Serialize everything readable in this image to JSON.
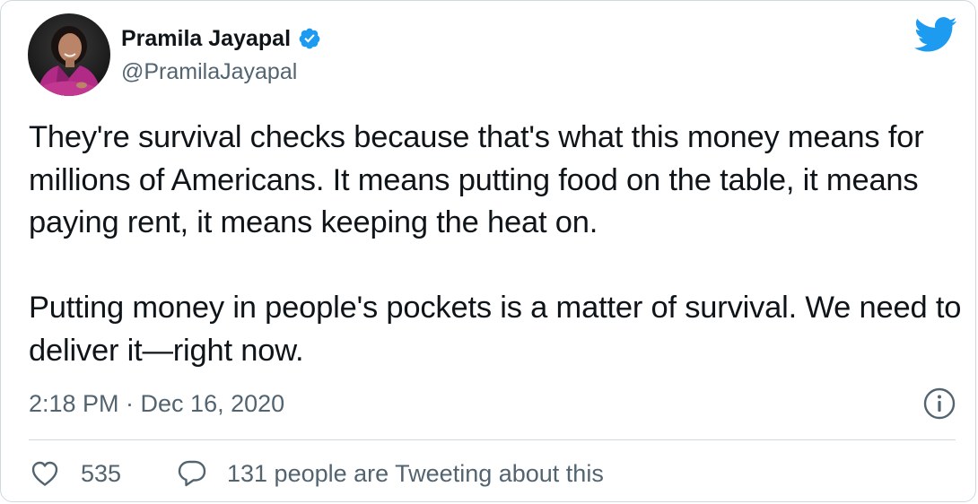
{
  "author": {
    "display_name": "Pramila Jayapal",
    "handle": "@PramilaJayapal",
    "verified": true
  },
  "tweet": {
    "paragraphs": [
      "They're survival checks because that's what this money means for millions of Americans. It means putting food on the table, it means paying rent, it means keeping the heat on.",
      "Putting money in people's pockets is a matter of survival. We need to deliver it—right now."
    ],
    "timestamp": "2:18 PM · Dec 16, 2020"
  },
  "footer": {
    "likes": "535",
    "tweeting": "131 people are Tweeting about this"
  },
  "icons": {
    "brand": "twitter-bird-icon",
    "verified": "verified-badge-icon",
    "info": "info-icon",
    "like": "heart-icon",
    "reply": "speech-bubble-icon"
  },
  "colors": {
    "twitter_blue": "#1d9bf0",
    "text": "#0f1419",
    "secondary": "#536471",
    "border": "#cfd9de"
  }
}
